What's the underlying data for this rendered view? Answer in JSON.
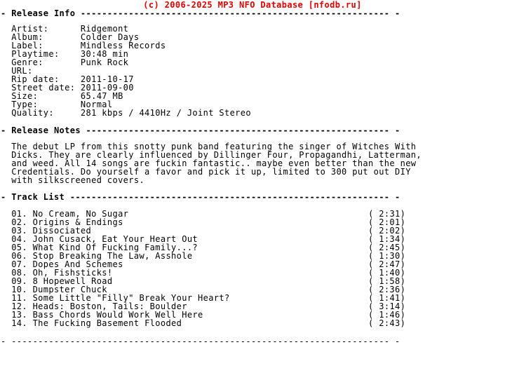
{
  "page": {
    "background_color": "#ffffff",
    "text_color": "#000000",
    "accent_color": "#e00000",
    "header_banner": "(c) 2006-2025 MP3 NFO Database [nfodb.ru]"
  },
  "sections": {
    "release_info": {
      "heading_label": "Release Info",
      "heading_line": "- Release Info ---------------------------------------------------------- -",
      "fields": [
        {
          "label": "Artist:",
          "value": "Ridgemont"
        },
        {
          "label": "Album:",
          "value": "Colder Days"
        },
        {
          "label": "Label:",
          "value": "Mindless Records"
        },
        {
          "label": "Playtime:",
          "value": "30:48 min"
        },
        {
          "label": "Genre:",
          "value": "Punk Rock"
        },
        {
          "label": "URL:",
          "value": ""
        },
        {
          "label": "Rip date:",
          "value": "2011-10-17"
        },
        {
          "label": "Street date:",
          "value": "2011-09-00"
        },
        {
          "label": "Size:",
          "value": "65.47 MB"
        },
        {
          "label": "Type:",
          "value": "Normal"
        },
        {
          "label": "Quality:",
          "value": "281 kbps / 4410Hz / Joint Stereo"
        }
      ]
    },
    "release_notes": {
      "heading_label": "Release Notes",
      "heading_line": "- Release Notes --------------------------------------------------------- -",
      "lines": [
        "The debut LP from this snotty punk band featuring the singer of Witches With",
        "Dicks. They are clearly influenced by Dillinger Four, Propagandhi, Latterman,",
        "and weed. All 14 songs are fuckin fantastic.. maybe even better than the new",
        "Credentials. Do yourself a favor and pick it up, limited to 300 put out DIY",
        "with silkscreened covers."
      ]
    },
    "track_list": {
      "heading_label": "Track List",
      "heading_line": "- Track List ------------------------------------------------------------ -",
      "tracks": [
        {
          "number": "01.",
          "title": "No Cream, No Sugar",
          "duration": "( 2:31)"
        },
        {
          "number": "02.",
          "title": "Origins & Endings",
          "duration": "( 2:01)"
        },
        {
          "number": "03.",
          "title": "Dissociated",
          "duration": "( 2:02)"
        },
        {
          "number": "04.",
          "title": "John Cusack, Eat Your Heart Out",
          "duration": "( 1:34)"
        },
        {
          "number": "05.",
          "title": "What Kind Of Fucking Family...?",
          "duration": "( 2:45)"
        },
        {
          "number": "06.",
          "title": "Stop Breaking The Law, Asshole",
          "duration": "( 1:30)"
        },
        {
          "number": "07.",
          "title": "Dopes And Schemes",
          "duration": "( 2:47)"
        },
        {
          "number": "08.",
          "title": "Oh, Fishsticks!",
          "duration": "( 1:40)"
        },
        {
          "number": "09.",
          "title": "8 Hopewell Road",
          "duration": "( 1:58)"
        },
        {
          "number": "10.",
          "title": "Dumpster Chuck",
          "duration": "( 2:36)"
        },
        {
          "number": "11.",
          "title": "Some Little \"Filly\" Break Your Heart?",
          "duration": "( 1:41)"
        },
        {
          "number": "12.",
          "title": "Heads: Boston, Tails: Boulder",
          "duration": "( 3:14)"
        },
        {
          "number": "13.",
          "title": "Bass Chords Would Work Well Here",
          "duration": "( 1:46)"
        },
        {
          "number": "14.",
          "title": "The Fucking Basement Flooded",
          "duration": "( 2:43)"
        }
      ]
    },
    "footer": {
      "rule": "- ----------------------------------------------------------------------- -"
    }
  }
}
